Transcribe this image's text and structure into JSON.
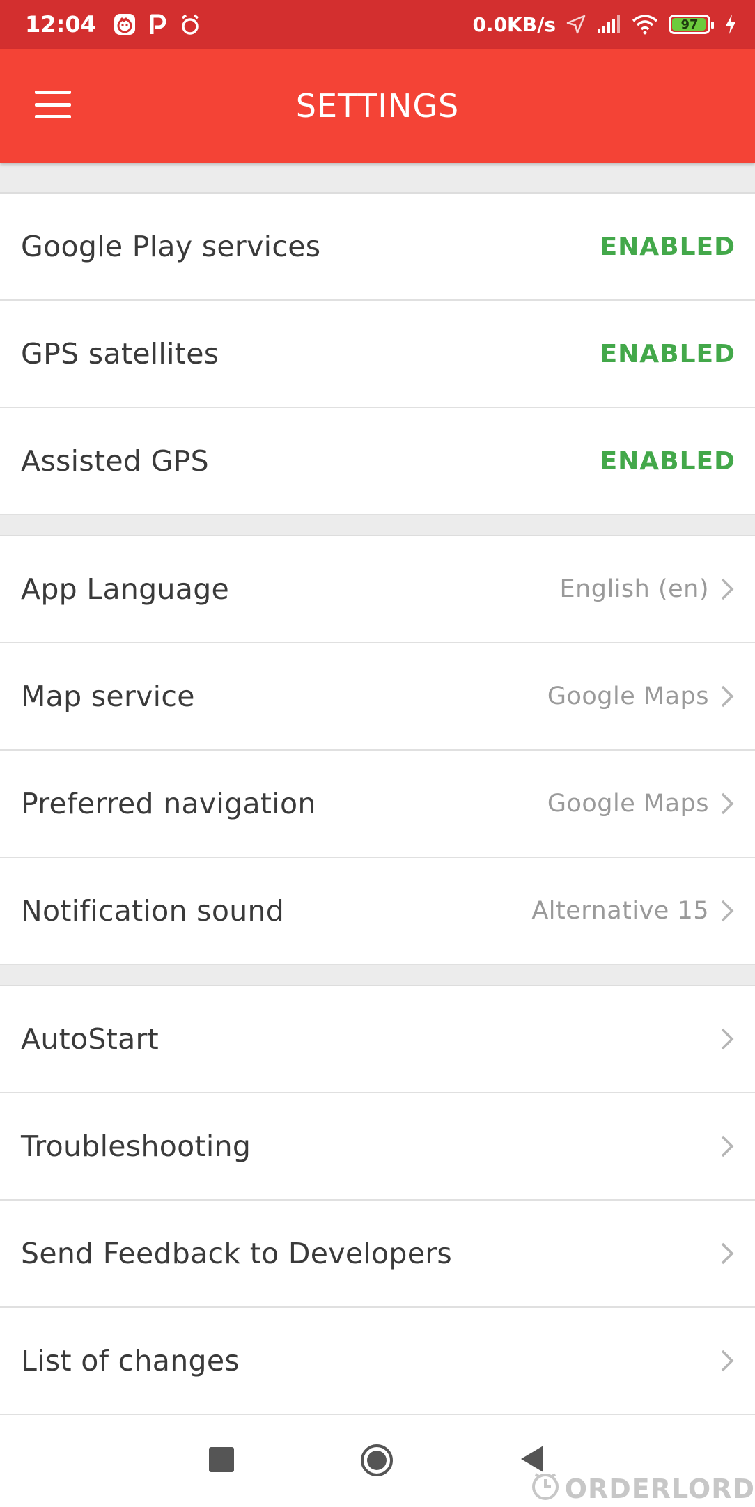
{
  "status_bar": {
    "time": "12:04",
    "net_speed": "0.0KB/s",
    "battery_level": "97",
    "battery_fraction": 0.97,
    "left_icons": [
      "baby-face-icon",
      "parking-icon",
      "alarm-icon"
    ],
    "right_icons": [
      "location-arrow-icon",
      "signal-icon",
      "wifi-icon",
      "battery-icon",
      "charging-icon"
    ]
  },
  "app_bar": {
    "title": "SETTINGS",
    "menu_icon": "hamburger-menu-icon"
  },
  "sections": {
    "services": [
      {
        "label": "Google Play services",
        "status": "ENABLED"
      },
      {
        "label": "GPS satellites",
        "status": "ENABLED"
      },
      {
        "label": "Assisted GPS",
        "status": "ENABLED"
      }
    ],
    "preferences": [
      {
        "label": "App Language",
        "value": "English (en)"
      },
      {
        "label": "Map service",
        "value": "Google Maps"
      },
      {
        "label": "Preferred navigation",
        "value": "Google Maps"
      },
      {
        "label": "Notification sound",
        "value": "Alternative 15"
      }
    ],
    "misc": [
      {
        "label": "AutoStart"
      },
      {
        "label": "Troubleshooting"
      },
      {
        "label": "Send Feedback to Developers"
      },
      {
        "label": "List of changes"
      }
    ]
  },
  "nav_bar": {
    "buttons": [
      "recent-apps-icon",
      "home-icon",
      "back-icon"
    ]
  },
  "watermark": {
    "text": "ORDERLORD"
  },
  "colors": {
    "status_bar": "#d32f2f",
    "app_bar": "#f44336",
    "enabled": "#43a84a",
    "value_text": "#9a9a9a"
  }
}
